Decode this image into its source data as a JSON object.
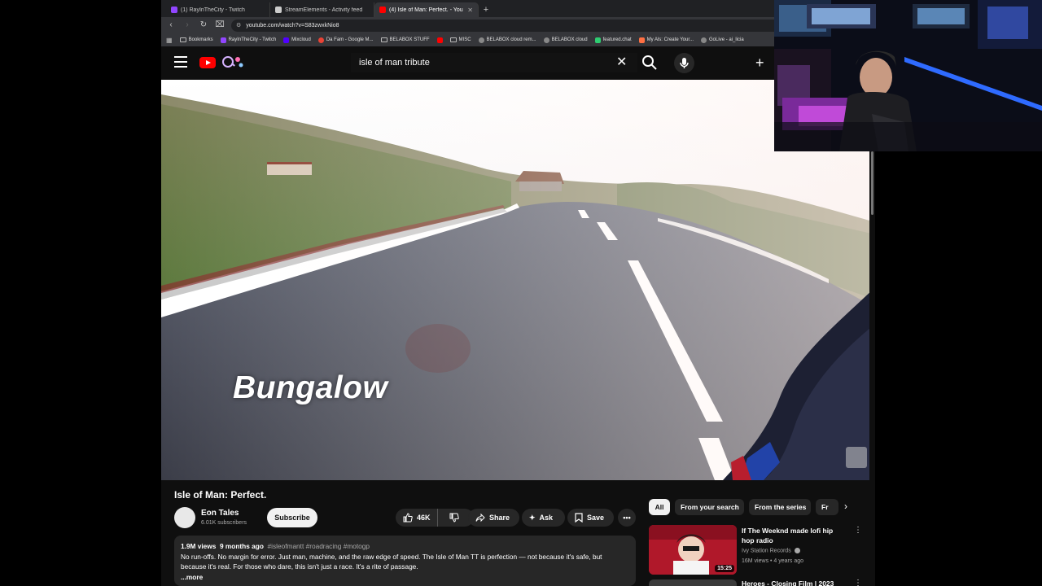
{
  "browser": {
    "tabs": [
      {
        "title": "(1) RayInTheCity - Twitch",
        "favicon_color": "#9146ff",
        "active": false
      },
      {
        "title": "StreamElements - Activity feed",
        "favicon_color": "#cccccc",
        "active": false
      },
      {
        "title": "(4) Isle of Man: Perfect. - You",
        "favicon_color": "#ff0000",
        "active": true
      }
    ],
    "new_tab_icon": "plus-icon",
    "url": "youtube.com/watch?v=S83zwxkNio8",
    "bookmarks": [
      {
        "label": "Bookmarks",
        "icon": "folder-icon"
      },
      {
        "label": "RayInTheCity - Twitch",
        "icon": "#9146ff"
      },
      {
        "label": "Mixcloud",
        "icon": "#5000ff"
      },
      {
        "label": "Da Fam - Google M...",
        "icon": "#ea4335"
      },
      {
        "label": "BELABOX STUFF",
        "icon": "folder-icon"
      },
      {
        "label": "",
        "icon": "#ff0000"
      },
      {
        "label": "MISC",
        "icon": "folder-icon"
      },
      {
        "label": "BELABOX cloud rem...",
        "icon": "globe-icon"
      },
      {
        "label": "BELABOX cloud",
        "icon": "globe-icon"
      },
      {
        "label": "featured.chat",
        "icon": "#2ecc71"
      },
      {
        "label": "My Als: Create Your...",
        "icon": "#ff7043"
      },
      {
        "label": "GoLive - ai_licia",
        "icon": "globe-icon"
      }
    ]
  },
  "youtube": {
    "search_query": "isle of man tribute",
    "video": {
      "overlay_text": "Bungalow",
      "title": "Isle of Man: Perfect.",
      "channel": "Eon Tales",
      "subscribers": "6.01K subscribers",
      "subscribe_label": "Subscribe",
      "likes": "46K",
      "share_label": "Share",
      "ask_label": "Ask",
      "save_label": "Save",
      "views": "1.9M views",
      "age": "9 months ago",
      "hashtags": "#isleofmantt #roadracing #motogp",
      "description": "No run-offs. No margin for error. Just man, machine, and the raw edge of speed. The Isle of Man TT is perfection — not because it's safe, but because it's real. For those who dare, this isn't just a race. It's a rite of passage.",
      "more_label": "...more"
    },
    "chips": [
      "All",
      "From your search",
      "From the series",
      "Fr"
    ],
    "related": [
      {
        "title": "If The Weeknd made lofi hip hop radio",
        "channel": "Ivy Station Records",
        "views": "16M views",
        "age": "4 years ago",
        "duration": "15:25"
      },
      {
        "title": "Heroes - Closing Film | 2023"
      }
    ]
  },
  "colors": {
    "yt_background": "#0f0f0f",
    "yt_red": "#ff0000",
    "chip_selected": "#f1f1f1",
    "pill_background": "#272727"
  }
}
